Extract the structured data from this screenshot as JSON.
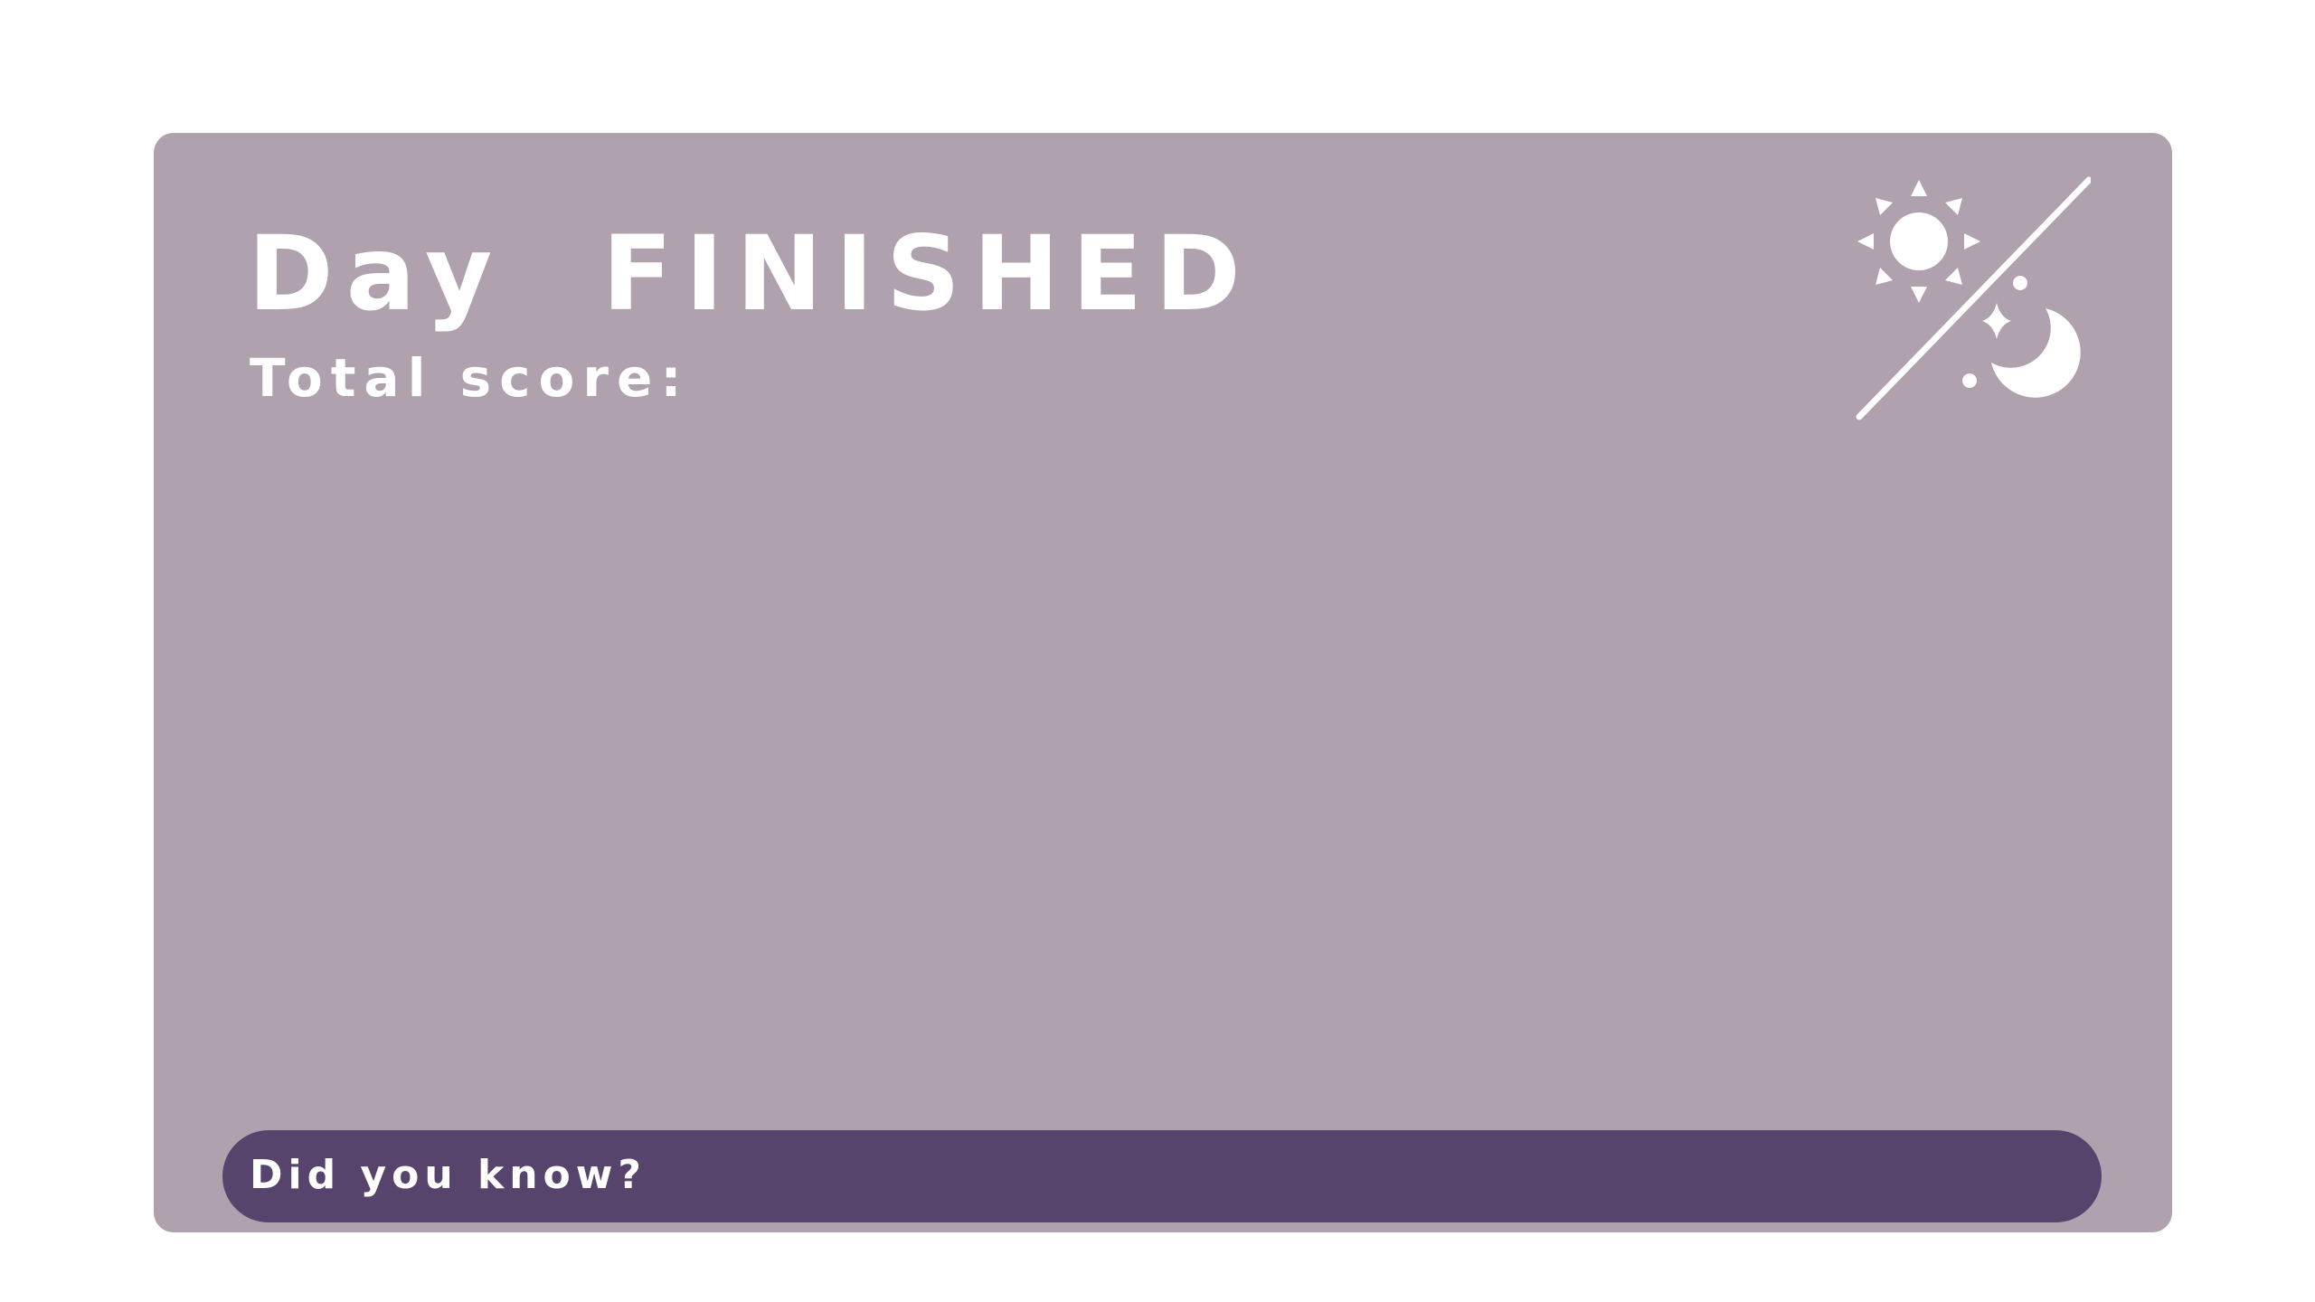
{
  "title": {
    "day_label": "Day",
    "status_label": "FINISHED"
  },
  "score": {
    "label": "Total score:"
  },
  "theme_toggle": {
    "icon": "sun-moon-toggle-icon"
  },
  "fact_box": {
    "title": "Did you know?"
  },
  "colors": {
    "page_background": "#ffffff",
    "card_background": "#afa1ae",
    "fact_bar_background": "#56446d",
    "text": "#ffffff"
  }
}
